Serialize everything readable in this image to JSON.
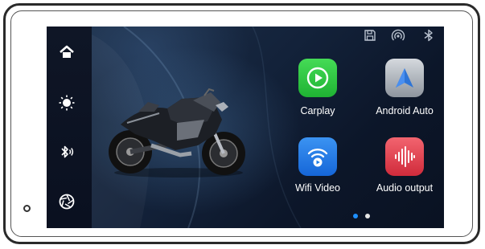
{
  "status_bar": {
    "icons": [
      "save-icon",
      "wifi-signal-icon",
      "bluetooth-icon"
    ]
  },
  "dock": {
    "items": [
      {
        "name": "home",
        "icon": "home-icon",
        "color": "#f36b1e"
      },
      {
        "name": "brightness",
        "icon": "sun-icon",
        "color": "#f4a516"
      },
      {
        "name": "bluetooth",
        "icon": "bluetooth-audio-icon",
        "color": "#2bb63a"
      },
      {
        "name": "camera",
        "icon": "aperture-icon",
        "color": "#1b86e8"
      }
    ]
  },
  "apps": [
    {
      "label": "Carplay",
      "icon": "carplay-play-icon",
      "color": "#28c93f"
    },
    {
      "label": "Android Auto",
      "icon": "android-auto-arrow-icon",
      "color": "#a9b0b8"
    },
    {
      "label": "Wifi Video",
      "icon": "wifi-video-icon",
      "color": "#1e7de6"
    },
    {
      "label": "Audio output",
      "icon": "audio-waveform-icon",
      "color": "#e4404e"
    }
  ],
  "pager": {
    "pages": 2,
    "current": 1
  },
  "colors": {
    "screen_bg": "#070d1d",
    "active_dot": "#1e90ff",
    "inactive_dot": "#e6e6e6"
  }
}
